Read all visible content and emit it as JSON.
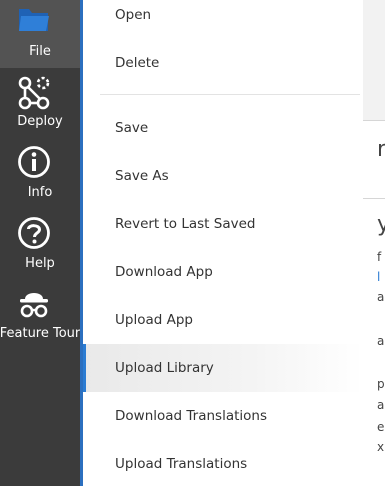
{
  "rail": {
    "items": [
      {
        "label": "File",
        "icon": "folder-icon",
        "active": true
      },
      {
        "label": "Deploy",
        "icon": "deploy-icon"
      },
      {
        "label": "Info",
        "icon": "info-icon"
      },
      {
        "label": "Help",
        "icon": "help-icon"
      },
      {
        "label": "Feature Tour",
        "icon": "feature-tour-icon"
      }
    ]
  },
  "menu": {
    "items": [
      {
        "label": "Open"
      },
      {
        "label": "Delete"
      },
      {
        "label": "Save"
      },
      {
        "label": "Save As"
      },
      {
        "label": "Revert to Last Saved"
      },
      {
        "label": "Download App"
      },
      {
        "label": "Upload App"
      },
      {
        "label": "Upload Library",
        "state": "hovered"
      },
      {
        "label": "Download Translations"
      },
      {
        "label": "Upload Translations"
      }
    ]
  },
  "background_fragments": [
    "n",
    "y",
    "f",
    "l",
    "a",
    "a",
    "p",
    "a",
    "e",
    "xp"
  ],
  "colors": {
    "rail_bg": "#3b3b3b",
    "rail_active_bg": "#535353",
    "accent": "#2b7cd3",
    "folder_icon": "#2f7fd8"
  }
}
